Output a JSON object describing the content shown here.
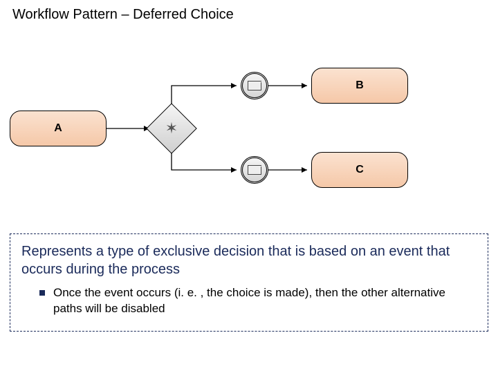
{
  "title": "Workflow Pattern – Deferred Choice",
  "diagram": {
    "activities": {
      "a": "A",
      "b": "B",
      "c": "C"
    },
    "gateway": {
      "name": "event-based-gateway",
      "symbol": "✶"
    },
    "events": {
      "top": "message-event",
      "bottom": "message-event"
    }
  },
  "description": {
    "main": "Represents a type of exclusive decision that is based on an event that occurs during the process",
    "bullet": "Once the event occurs (i. e. , the choice is made), then the other alternative paths will be disabled"
  }
}
